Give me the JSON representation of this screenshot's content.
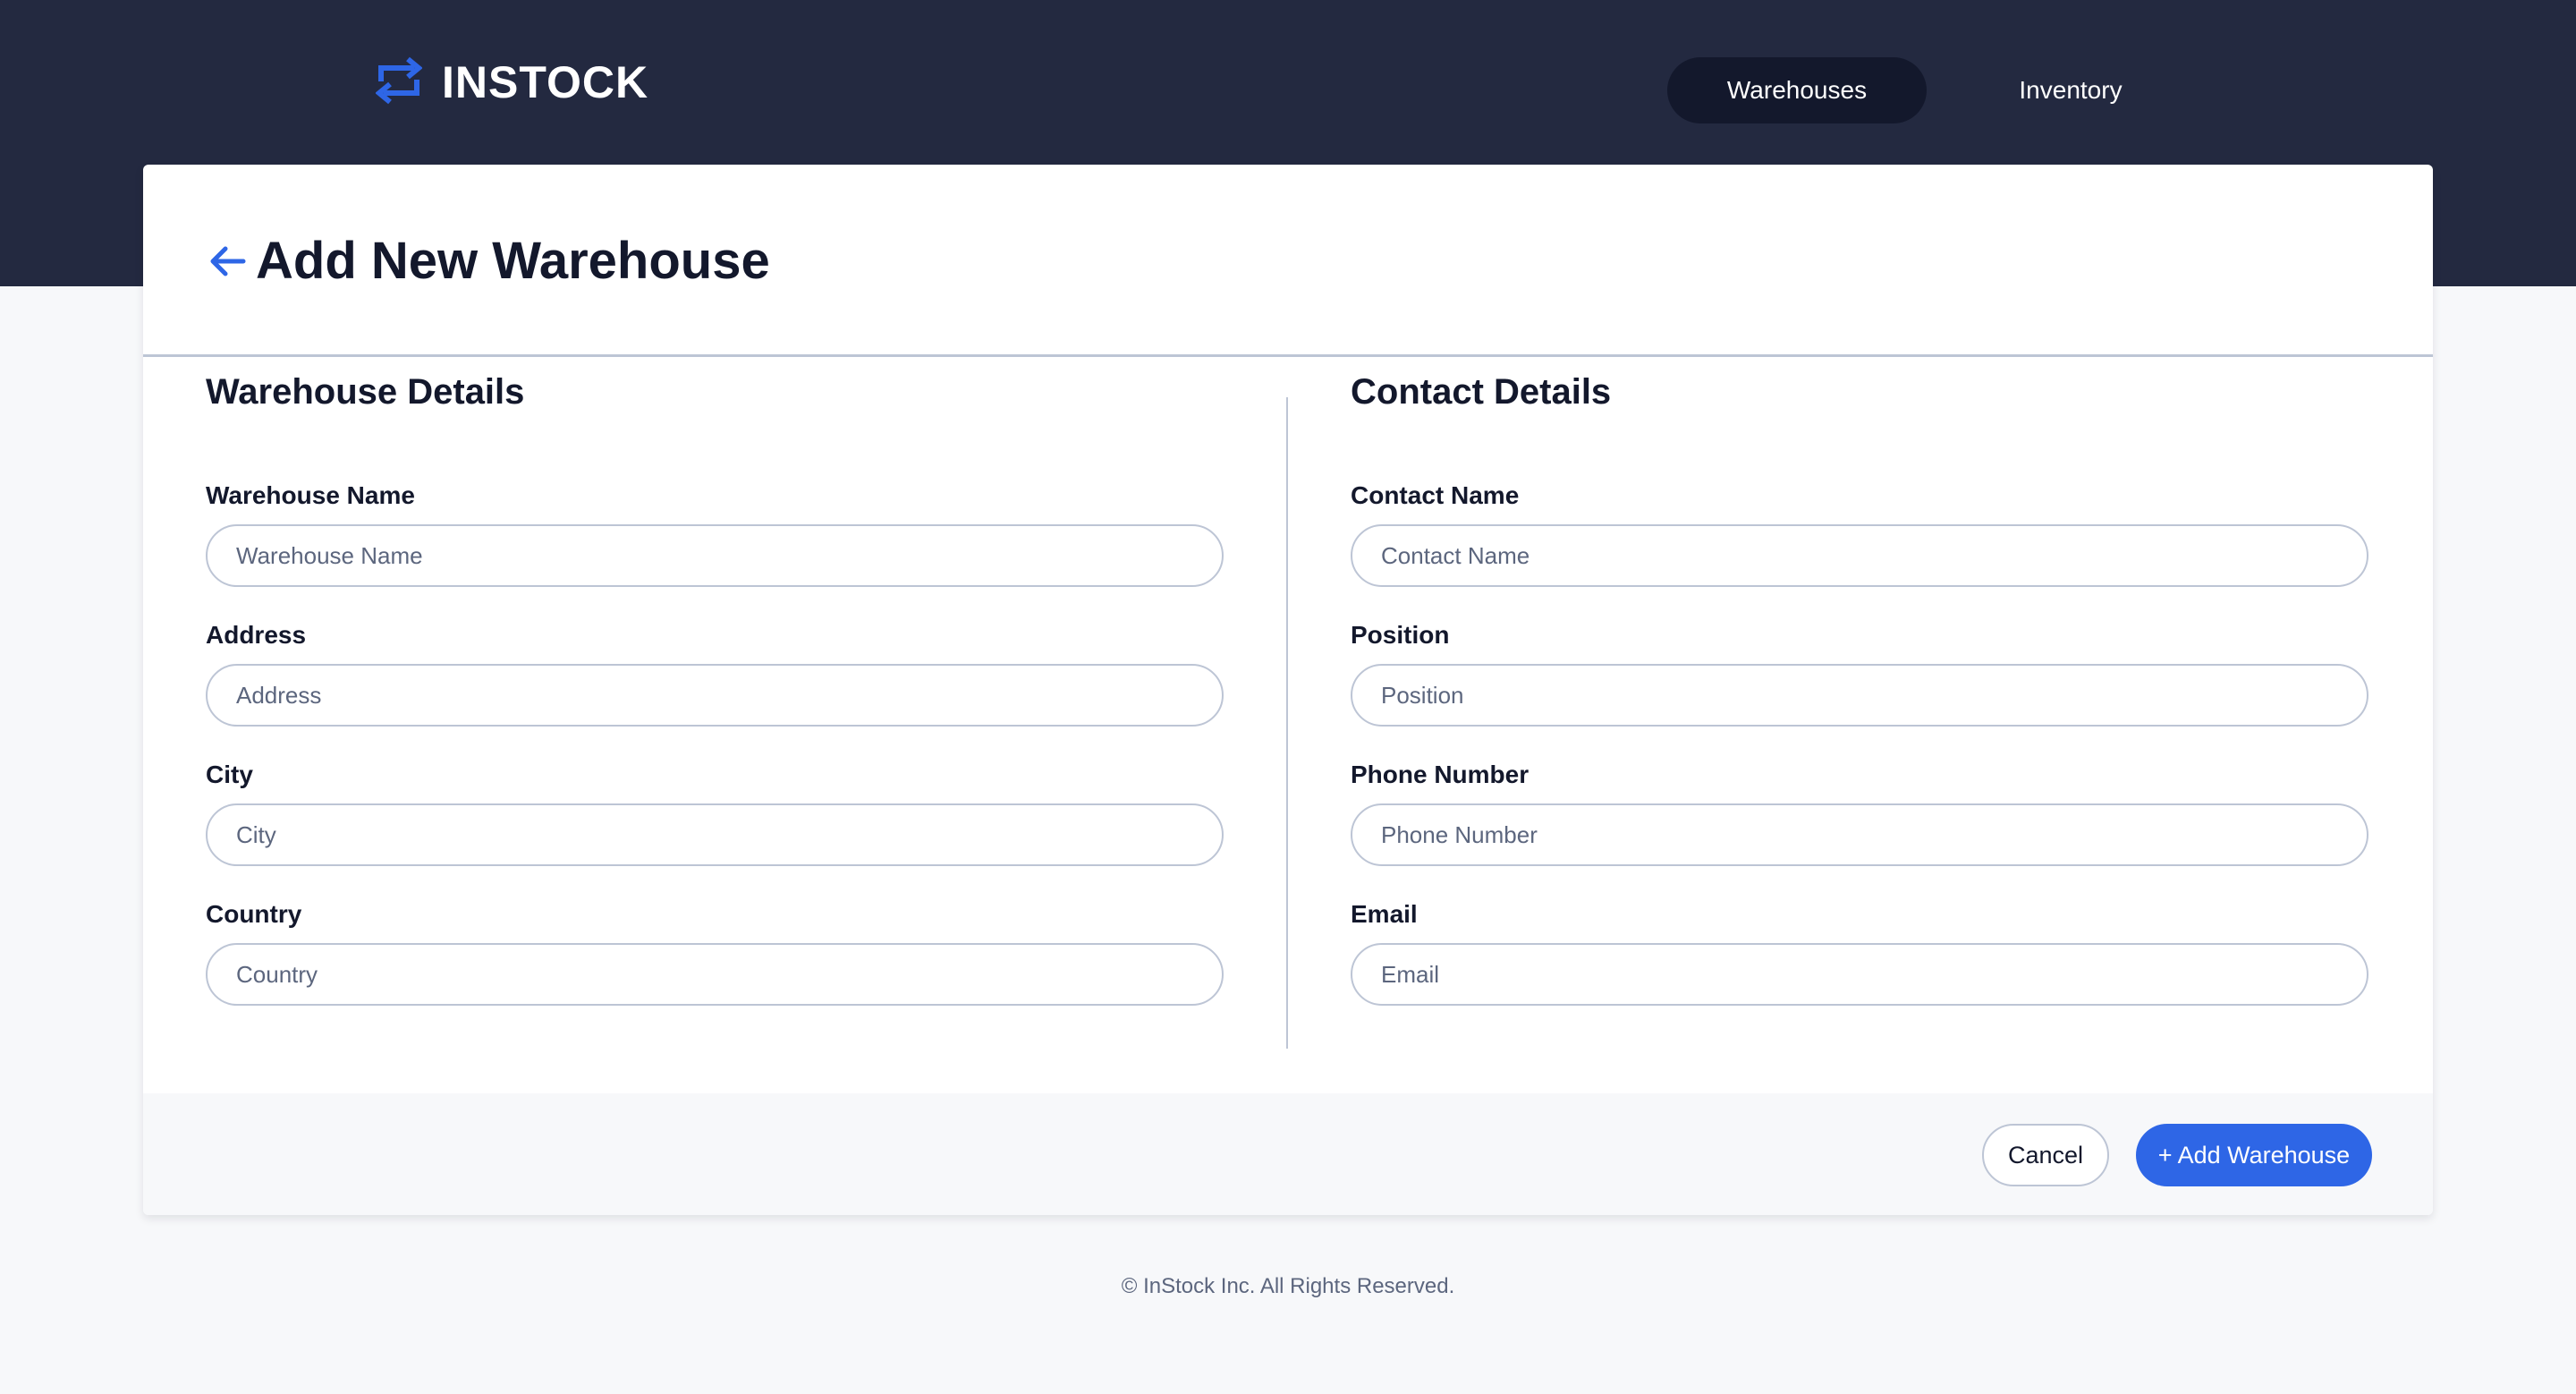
{
  "colors": {
    "header_bg": "#232940",
    "nav_active_bg": "#13182c",
    "accent": "#2e66e6",
    "border": "#bdc5d5",
    "page_bg": "#f7f8fa",
    "text_primary": "#13182c",
    "text_secondary": "#5c667e"
  },
  "header": {
    "logo_icon": "swap-arrows-icon",
    "logo_text": "INSTOCK",
    "nav": {
      "warehouses": "Warehouses",
      "inventory": "Inventory",
      "active": "Warehouses"
    }
  },
  "page": {
    "back_icon": "arrow-left-icon",
    "title": "Add New Warehouse"
  },
  "warehouse_details": {
    "title": "Warehouse Details",
    "fields": {
      "name": {
        "label": "Warehouse Name",
        "placeholder": "Warehouse Name",
        "value": ""
      },
      "address": {
        "label": "Address",
        "placeholder": "Address",
        "value": ""
      },
      "city": {
        "label": "City",
        "placeholder": "City",
        "value": ""
      },
      "country": {
        "label": "Country",
        "placeholder": "Country",
        "value": ""
      }
    }
  },
  "contact_details": {
    "title": "Contact Details",
    "fields": {
      "name": {
        "label": "Contact Name",
        "placeholder": "Contact Name",
        "value": ""
      },
      "position": {
        "label": "Position",
        "placeholder": "Position",
        "value": ""
      },
      "phone": {
        "label": "Phone Number",
        "placeholder": "Phone Number",
        "value": ""
      },
      "email": {
        "label": "Email",
        "placeholder": "Email",
        "value": ""
      }
    }
  },
  "actions": {
    "cancel": "Cancel",
    "submit": "+ Add Warehouse"
  },
  "footer": {
    "copyright": "© InStock Inc. All Rights Reserved."
  }
}
